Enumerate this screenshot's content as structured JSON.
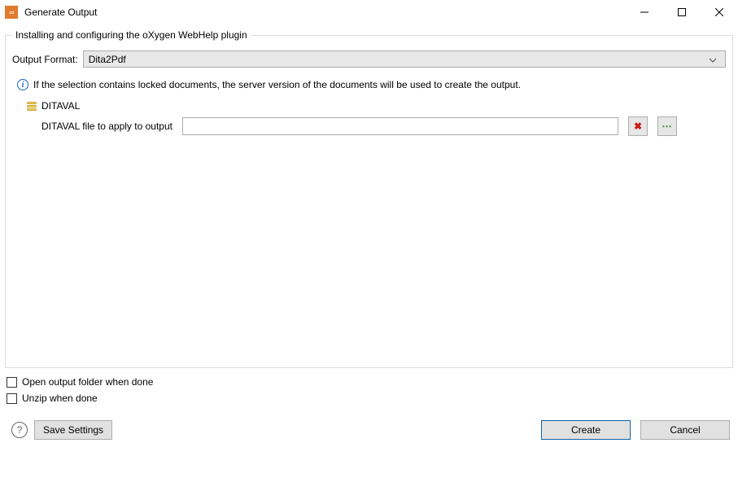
{
  "window": {
    "title": "Generate Output"
  },
  "group": {
    "legend": "Installing and configuring the oXygen WebHelp plugin"
  },
  "format": {
    "label": "Output Format:",
    "value": "Dita2Pdf"
  },
  "info": {
    "text": "If the selection contains locked documents, the server version of the documents will be used to create the output."
  },
  "ditaval": {
    "group_label": "DITAVAL",
    "field_label": "DITAVAL file to apply to output",
    "value": ""
  },
  "options": {
    "open_output_folder": "Open output folder when done",
    "unzip_when_done": "Unzip when done"
  },
  "footer": {
    "save_settings": "Save Settings",
    "create": "Create",
    "cancel": "Cancel"
  }
}
